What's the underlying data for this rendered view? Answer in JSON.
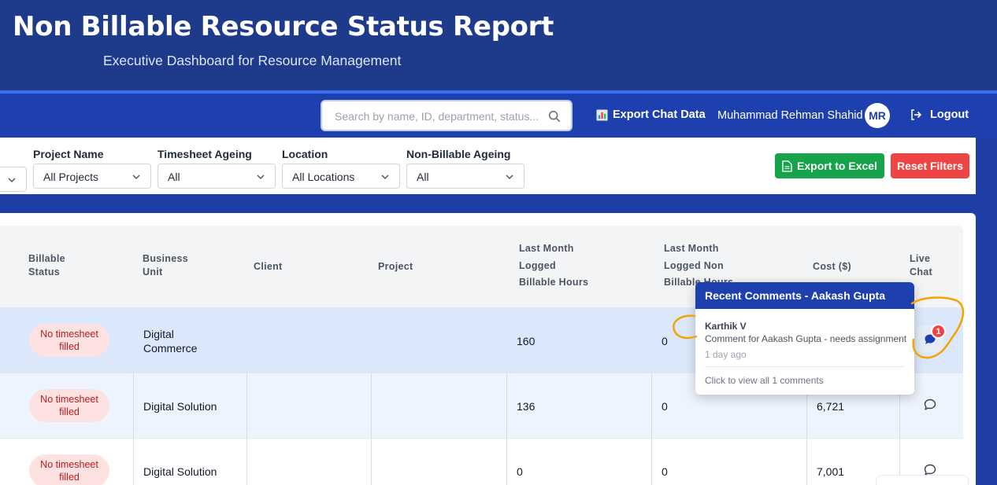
{
  "header": {
    "title": "Non Billable Resource Status Report",
    "subtitle": "Executive Dashboard for Resource Management"
  },
  "nav": {
    "search_placeholder": "Search by name, ID, department, status...",
    "export_chat_label": "Export Chat Data",
    "user_name": "Muhammad Rehman Shahid",
    "user_initials": "MR",
    "logout_label": "Logout"
  },
  "filters": {
    "project_name": {
      "label": "Project Name",
      "value": "All Projects"
    },
    "timesheet_ageing": {
      "label": "Timesheet Ageing",
      "value": "All"
    },
    "location": {
      "label": "Location",
      "value": "All Locations"
    },
    "non_billable_ageing": {
      "label": "Non-Billable Ageing",
      "value": "All"
    },
    "export_excel_label": "Export to Excel",
    "reset_label": "Reset Filters"
  },
  "table": {
    "headers": {
      "billable_status": [
        "Billable",
        "Status"
      ],
      "business_unit": [
        "Business",
        "Unit"
      ],
      "client": "Client",
      "project": "Project",
      "billable_hours": [
        "Last Month",
        "Logged",
        "Billable Hours"
      ],
      "non_billable": [
        "Last Month",
        "Logged Non",
        "Billable Hours"
      ],
      "cost": "Cost ($)",
      "live_chat": [
        "Live",
        "Chat"
      ]
    },
    "rows": [
      {
        "status": [
          "No timesheet",
          "filled"
        ],
        "unit": [
          "Digital",
          "Commerce"
        ],
        "client": "",
        "project": "",
        "billable": "160",
        "non_billable": "0",
        "cost": "",
        "chat_unread": "1"
      },
      {
        "status": [
          "No timesheet",
          "filled"
        ],
        "unit": [
          "Digital Solution"
        ],
        "client": "",
        "project": "",
        "billable": "136",
        "non_billable": "0",
        "cost": "6,721"
      },
      {
        "status": [
          "No timesheet",
          "filled"
        ],
        "unit": [
          "Digital Solution"
        ],
        "client": "",
        "project": "",
        "billable": "0",
        "non_billable": "0",
        "cost": "7,001"
      }
    ]
  },
  "popup": {
    "title": "Recent Comments - Aakash Gupta",
    "author": "Karthik V",
    "text": "Comment for Aakash Gupta - needs assignment",
    "time": "1 day ago",
    "view_all": "Click to view all 1 comments"
  },
  "colors": {
    "header_bg": "#1e3a8a",
    "nav_bg": "#1e40af",
    "excel_btn": "#16a34a",
    "reset_btn": "#ef4444",
    "badge_bg": "#fee2e2",
    "badge_text": "#b91c1c",
    "annotation": "#f5a300"
  },
  "icons": [
    "search-icon",
    "chart-icon",
    "logout-icon",
    "chevron-down-icon",
    "spreadsheet-icon",
    "chat-icon"
  ]
}
